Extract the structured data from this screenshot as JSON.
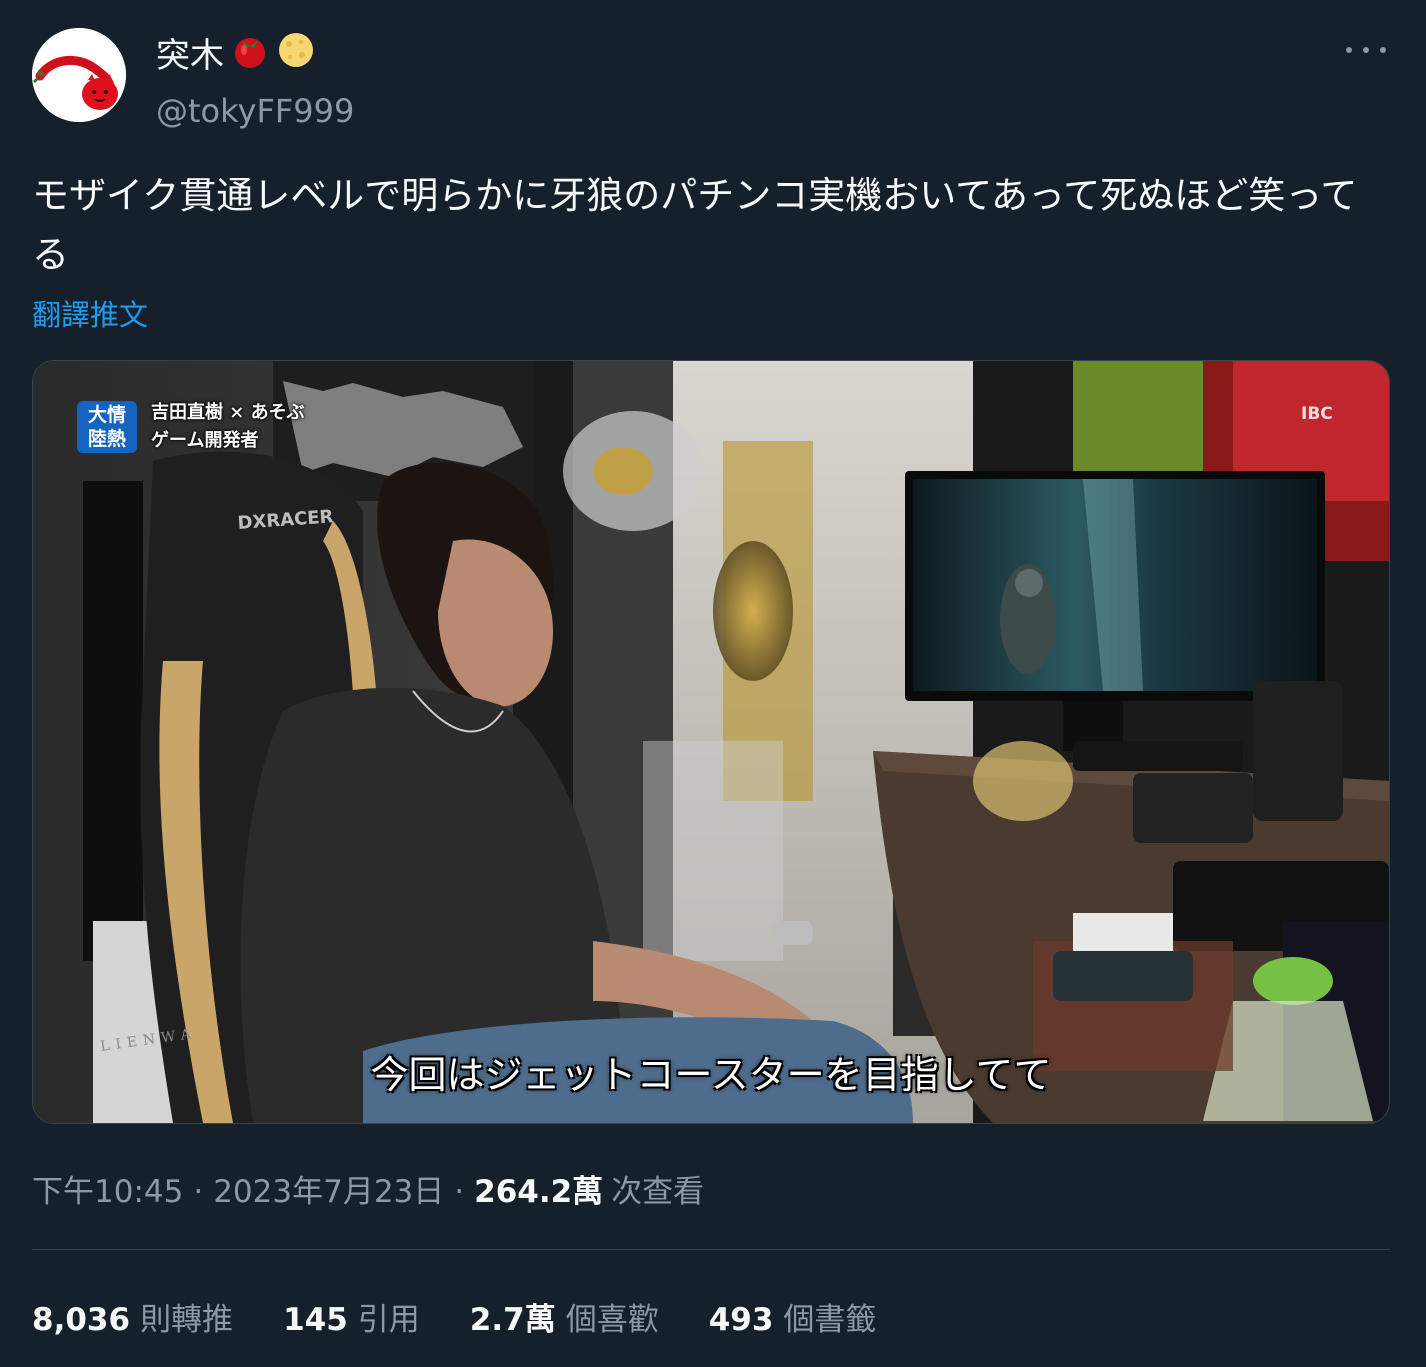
{
  "author": {
    "display_name": "突木",
    "emojis": [
      "tomato-icon",
      "cheese-icon"
    ],
    "handle": "@tokyFF999"
  },
  "tweet": {
    "text": "モザイク貫通レベルで明らかに牙狼のパチンコ実機おいてあって死ぬほど笑ってる",
    "translate_label": "翻譯推文"
  },
  "media": {
    "caption": "今回はジェットコースターを目指してて",
    "badge": "大情\n陸熱",
    "overlay_line1": "吉田直樹 × あそぶ",
    "overlay_line2": "ゲーム開発者",
    "chair_brand": "DXRACER",
    "tag_ibc": "IBC",
    "side_brand": "LIENWA"
  },
  "meta": {
    "time": "下午10:45",
    "date": "2023年7月23日",
    "views_count": "264.2萬",
    "views_label": "次查看"
  },
  "stats": [
    {
      "num": "8,036",
      "label": "則轉推"
    },
    {
      "num": "145",
      "label": "引用"
    },
    {
      "num": "2.7萬",
      "label": "個喜歡"
    },
    {
      "num": "493",
      "label": "個書籤"
    }
  ],
  "colors": {
    "background": "#15202b",
    "text": "#f7f9f9",
    "secondary": "#8b98a5",
    "link": "#1d9bf0",
    "border": "#38444d"
  }
}
